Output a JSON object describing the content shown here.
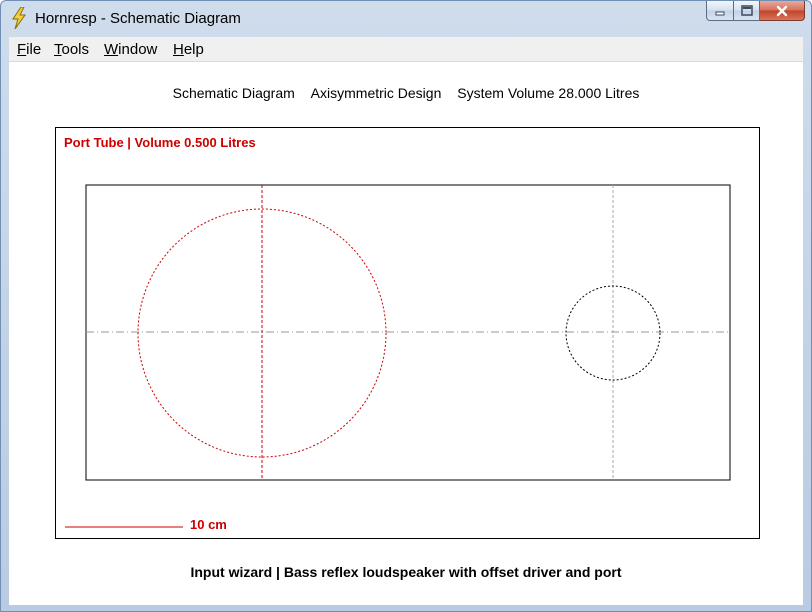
{
  "window": {
    "title": "Hornresp - Schematic Diagram",
    "app_icon": "lightning-bolt-icon",
    "caption_buttons": [
      "minimize-icon",
      "maximize-icon",
      "close-icon"
    ]
  },
  "menu": {
    "file": {
      "mnemonic": "F",
      "rest": "ile"
    },
    "tools": {
      "mnemonic": "T",
      "rest": "ools"
    },
    "window": {
      "mnemonic": "W",
      "rest": "indow"
    },
    "help": {
      "mnemonic": "H",
      "rest": "elp"
    }
  },
  "header": {
    "diagram": "Schematic Diagram",
    "design": "Axisymmetric Design",
    "volume": "System Volume 28.000 Litres"
  },
  "diagram": {
    "port_label": "Port Tube | Volume 0.500 Litres",
    "scale_label": "10 cm",
    "highlight_color": "#cc0000",
    "line_color": "#000000"
  },
  "footer": {
    "text": "Input wizard | Bass reflex loudspeaker with offset driver and port"
  }
}
